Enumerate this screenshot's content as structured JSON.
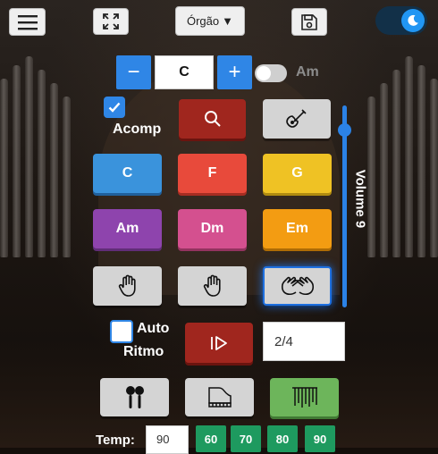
{
  "topbar": {
    "instrument_label": "Órgão",
    "dropdown_arrow": "▼",
    "icons": [
      "menu-icon",
      "fullscreen-icon",
      "save-icon",
      "moon-icon"
    ]
  },
  "key": {
    "minus": "−",
    "value": "C",
    "plus": "+",
    "minor_label": "Am",
    "minor_on": false
  },
  "accomp": {
    "label": "Acomp",
    "checked": true
  },
  "chords": [
    "C",
    "F",
    "G",
    "Am",
    "Dm",
    "Em"
  ],
  "volume": {
    "label": "Volume 9",
    "level": 9
  },
  "auto_rhythm": {
    "auto_label": "Auto",
    "rhythm_label": "Ritmo",
    "checked": false
  },
  "time_signature": "2/4",
  "tempo": {
    "label": "Temp:",
    "value": "90",
    "presets": [
      "60",
      "70",
      "80",
      "90"
    ]
  },
  "colors": {
    "accent": "#2196f3",
    "chord_C": "#3a93dc",
    "chord_F": "#e84a3b",
    "chord_G": "#efc224",
    "chord_Am": "#8e44ad",
    "chord_Dm": "#d4508f",
    "chord_Em": "#f39c12",
    "tempo": "#1e9a5f"
  }
}
